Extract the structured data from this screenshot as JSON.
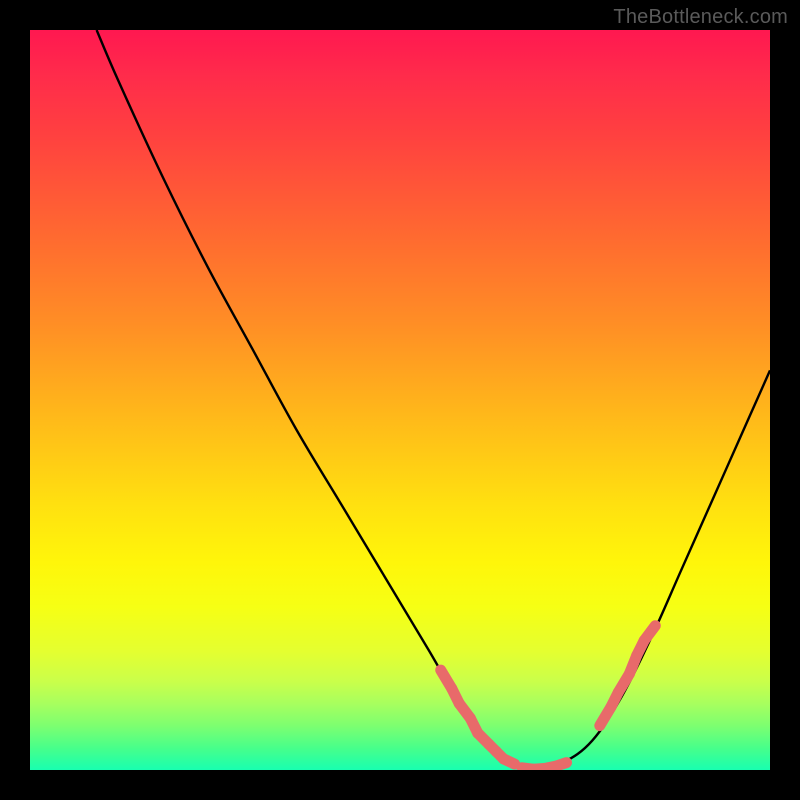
{
  "watermark": "TheBottleneck.com",
  "colors": {
    "background": "#000000",
    "curve": "#000000",
    "marker": "#e86a6a",
    "gradient_stops": [
      "#ff1850",
      "#ff2b4b",
      "#ff4040",
      "#ff6a30",
      "#ff8f25",
      "#ffb81a",
      "#ffe010",
      "#fff60a",
      "#f6ff14",
      "#e4ff30",
      "#caff4a",
      "#a8ff5e",
      "#7dff70",
      "#48ff8a",
      "#18ffb0"
    ]
  },
  "chart_data": {
    "type": "line",
    "title": "",
    "xlabel": "",
    "ylabel": "",
    "xlim": [
      0,
      100
    ],
    "ylim": [
      0,
      100
    ],
    "series": [
      {
        "name": "bottleneck-curve",
        "x": [
          9,
          12,
          18,
          24,
          30,
          36,
          42,
          48,
          54,
          58,
          60,
          62,
          65,
          68,
          72,
          76,
          80,
          84,
          88,
          92,
          96,
          100
        ],
        "values": [
          100,
          93,
          80,
          68,
          57,
          46,
          36,
          26,
          16,
          9,
          6,
          3,
          1,
          0,
          1,
          4,
          10,
          18,
          27,
          36,
          45,
          54
        ]
      }
    ],
    "markers_left": {
      "name": "markers-descending",
      "x": [
        55.5,
        57.0,
        58.0,
        59.5,
        60.5,
        62.0,
        63.0,
        64.0,
        65.5
      ],
      "values": [
        13.5,
        11.0,
        9.0,
        7.0,
        5.0,
        3.5,
        2.5,
        1.5,
        0.8
      ]
    },
    "markers_bottom": {
      "name": "markers-trough",
      "x": [
        66.5,
        68.0,
        69.5,
        71.0,
        72.5
      ],
      "values": [
        0.3,
        0.1,
        0.2,
        0.5,
        1.0
      ]
    },
    "markers_right": {
      "name": "markers-ascending",
      "x": [
        77.0,
        78.5,
        79.5,
        81.0,
        82.0,
        83.0,
        84.5
      ],
      "values": [
        6.0,
        8.5,
        10.5,
        13.0,
        15.5,
        17.5,
        19.5
      ]
    }
  }
}
